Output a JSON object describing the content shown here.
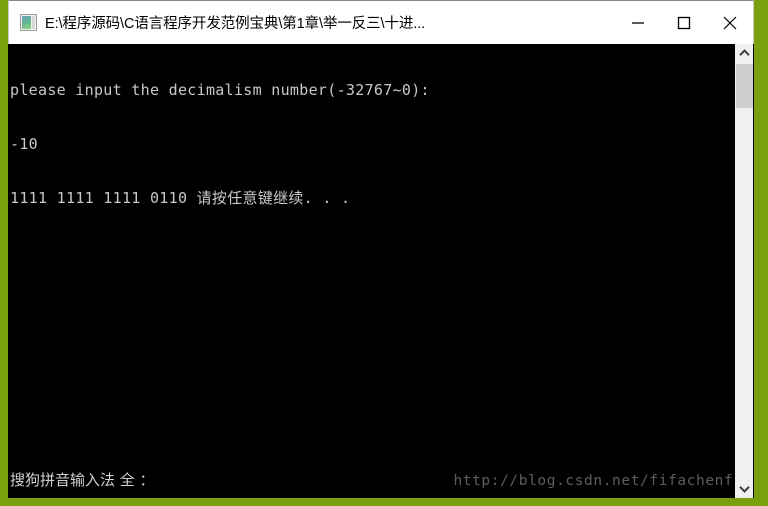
{
  "desktop": {
    "background_color": "#79a00d"
  },
  "window": {
    "icon_name": "console-window-icon",
    "title": "E:\\程序源码\\C语言程序开发范例宝典\\第1章\\举一反三\\十进...",
    "controls": {
      "minimize_label": "Minimize",
      "maximize_label": "Maximize",
      "close_label": "Close"
    }
  },
  "console": {
    "background_color": "#000000",
    "text_color": "#c8c8c8",
    "lines": [
      "please input the decimalism number(-32767~0):",
      "-10",
      "1111 1111 1111 0110 请按任意键继续. . ."
    ],
    "ime_status": "搜狗拼音输入法 全 ：",
    "watermark": "http://blog.csdn.net/fifachenfan"
  },
  "scrollbar": {
    "up_arrow_name": "chevron-up-icon",
    "down_arrow_name": "chevron-down-icon",
    "thumb_color": "#cdcdcd",
    "track_color": "#f0f0f0"
  }
}
